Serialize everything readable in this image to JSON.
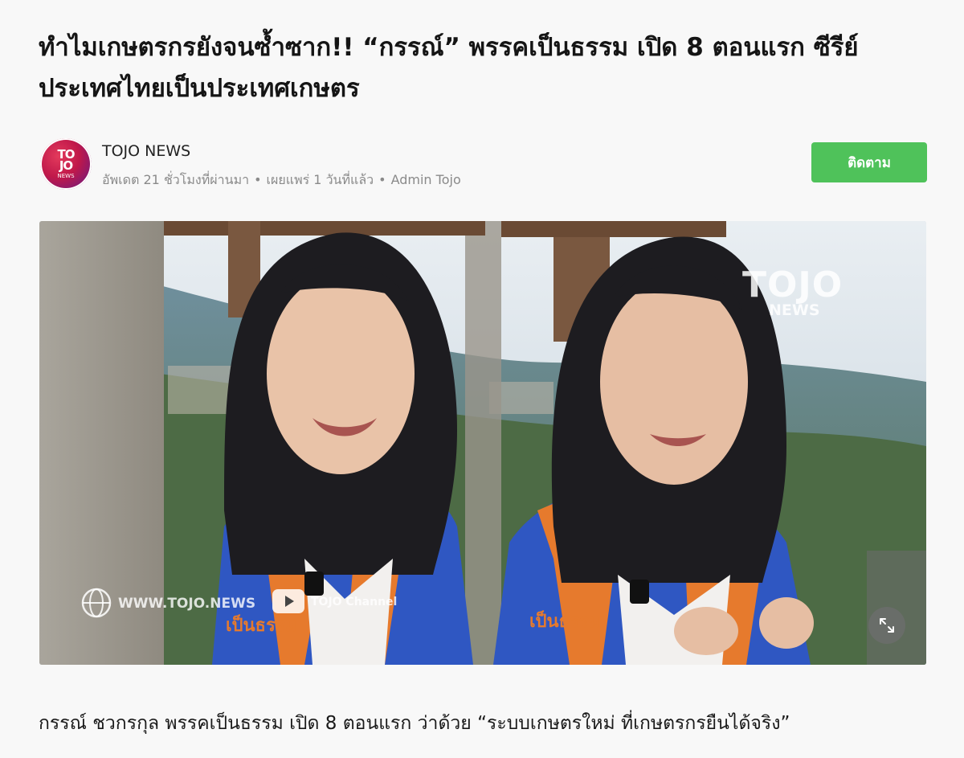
{
  "article": {
    "title": "ทำไมเกษตรกรยังจนซ้ำซาก!! “กรรณ์” พรรคเป็นธรรม เปิด 8 ตอนแรก ซีรีย์ ประเทศไทยเป็นประเทศเกษตร",
    "lead": "กรรณ์ ชวกรกุล พรรคเป็นธรรม เปิด 8 ตอนแรก ว่าด้วย “ระบบเกษตรใหม่ ที่เกษตรกรยืนได้จริง”"
  },
  "channel": {
    "logo_line1": "TO",
    "logo_line2": "JO",
    "logo_line3": "NEWS",
    "name": "TOJO NEWS",
    "updated": "อัพเดต 21 ชั่วโมงที่ผ่านมา",
    "published": "เผยแพร่ 1 วันที่แล้ว",
    "author": "Admin Tojo",
    "separator": "•",
    "follow_label": "ติดตาม",
    "follow_color": "#4fc25a"
  },
  "image": {
    "watermark_brand": "TOJO",
    "watermark_sub": "NEWS",
    "website": "WWW.TOJO.NEWS",
    "youtube": "TOJO Channel",
    "vest_text": "เป็นธรรม",
    "expand_icon": "expand-icon"
  }
}
